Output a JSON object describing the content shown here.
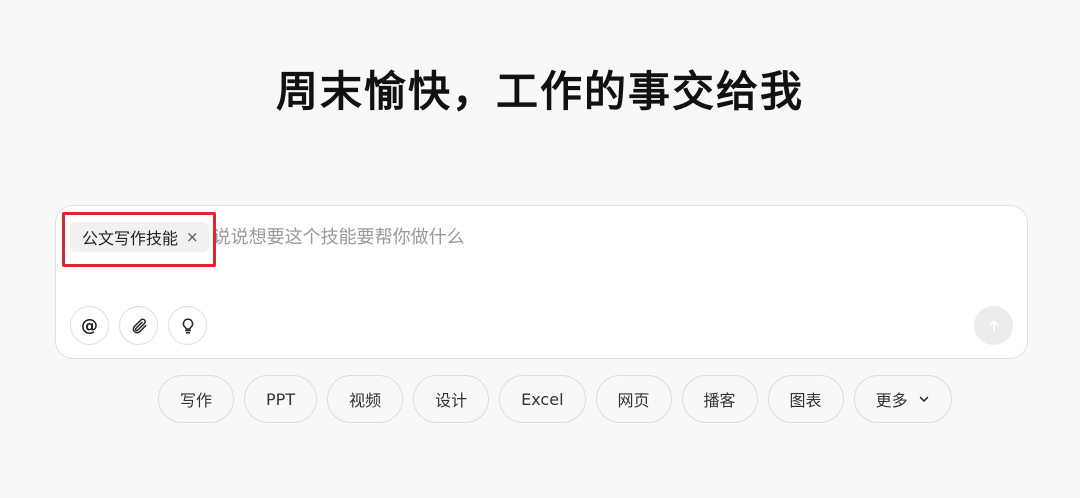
{
  "hero": {
    "title": "周末愉快，工作的事交给我"
  },
  "composer": {
    "skill_tag": "公文写作技能",
    "skill_tag_close": "×",
    "placeholder": "说说想要这个技能要帮你做什么",
    "tools": [
      {
        "name": "mention-icon",
        "glyph": "@"
      },
      {
        "name": "paperclip-icon"
      },
      {
        "name": "lightbulb-icon"
      }
    ],
    "send_icon": "arrow-up-icon"
  },
  "categories": [
    {
      "label": "写作"
    },
    {
      "label": "PPT"
    },
    {
      "label": "视频"
    },
    {
      "label": "设计"
    },
    {
      "label": "Excel"
    },
    {
      "label": "网页"
    },
    {
      "label": "播客"
    },
    {
      "label": "图表"
    },
    {
      "label": "更多"
    }
  ],
  "colors": {
    "background": "#f8f8f7",
    "highlight": "#e3262b",
    "chip": "#f1f1f0"
  }
}
